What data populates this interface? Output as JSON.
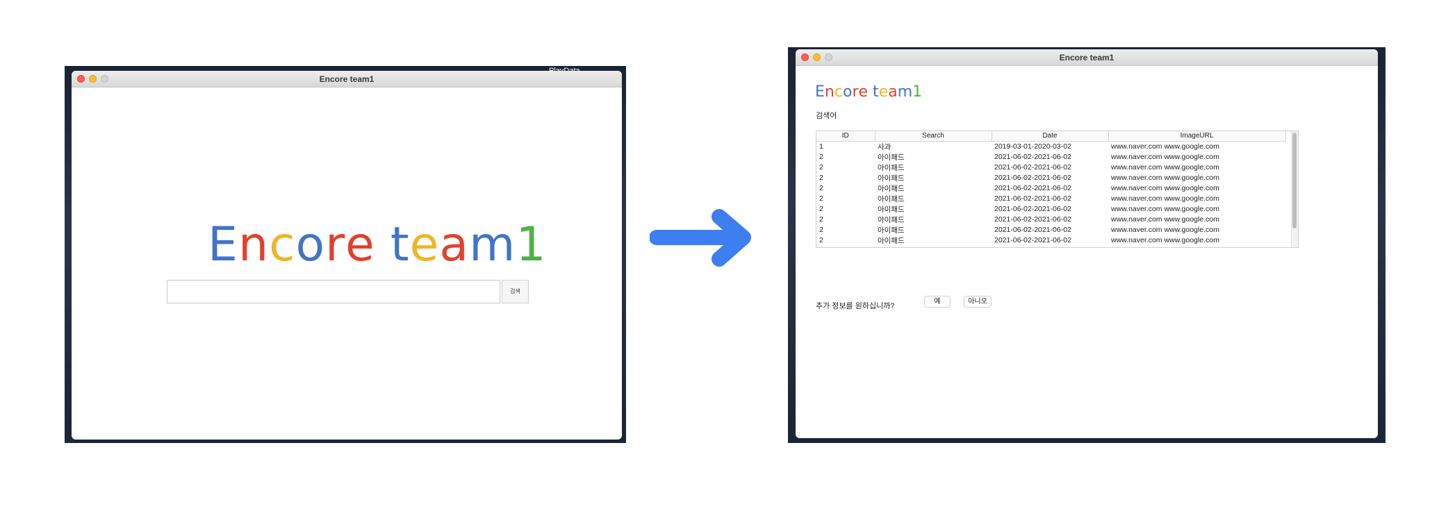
{
  "left_window": {
    "title": "Encore team1",
    "desktop_label": "PlayData",
    "logo": [
      "E",
      "n",
      "c",
      "o",
      "r",
      "e",
      " ",
      "t",
      "e",
      "a",
      "m",
      "1"
    ],
    "search_value": "",
    "search_button": "검색"
  },
  "right_window": {
    "title": "Encore team1",
    "logo": [
      "E",
      "n",
      "c",
      "o",
      "r",
      "e",
      " ",
      "t",
      "e",
      "a",
      "m",
      "1"
    ],
    "query_label": "검색어",
    "columns": [
      "ID",
      "Search",
      "Date",
      "ImageURL"
    ],
    "rows": [
      [
        "1",
        "사과",
        "2019-03-01-2020-03-02",
        "www.naver.com www.google.com"
      ],
      [
        "2",
        "아이패드",
        "2021-06-02-2021-06-02",
        "www.naver.com www.google.com"
      ],
      [
        "2",
        "아이패드",
        "2021-06-02-2021-06-02",
        "www.naver.com www.google.com"
      ],
      [
        "2",
        "아이패드",
        "2021-06-02-2021-06-02",
        "www.naver.com www.google.com"
      ],
      [
        "2",
        "아이패드",
        "2021-06-02-2021-06-02",
        "www.naver.com www.google.com"
      ],
      [
        "2",
        "아이패드",
        "2021-06-02-2021-06-02",
        "www.naver.com www.google.com"
      ],
      [
        "2",
        "아이패드",
        "2021-06-02-2021-06-02",
        "www.naver.com www.google.com"
      ],
      [
        "2",
        "아이패드",
        "2021-06-02-2021-06-02",
        "www.naver.com www.google.com"
      ],
      [
        "2",
        "아이패드",
        "2021-06-02-2021-06-02",
        "www.naver.com www.google.com"
      ],
      [
        "2",
        "아이패드",
        "2021-06-02-2021-06-02",
        "www.naver.com www.google.com"
      ]
    ],
    "more_info_question": "추가 정보를 원하십니까?",
    "yes_button": "예",
    "no_button": "아니오"
  },
  "colors": {
    "blue": "#4274c8",
    "red": "#e0412f",
    "yellow": "#eeb528",
    "green": "#50b148",
    "arrow": "#3d7ef0"
  }
}
